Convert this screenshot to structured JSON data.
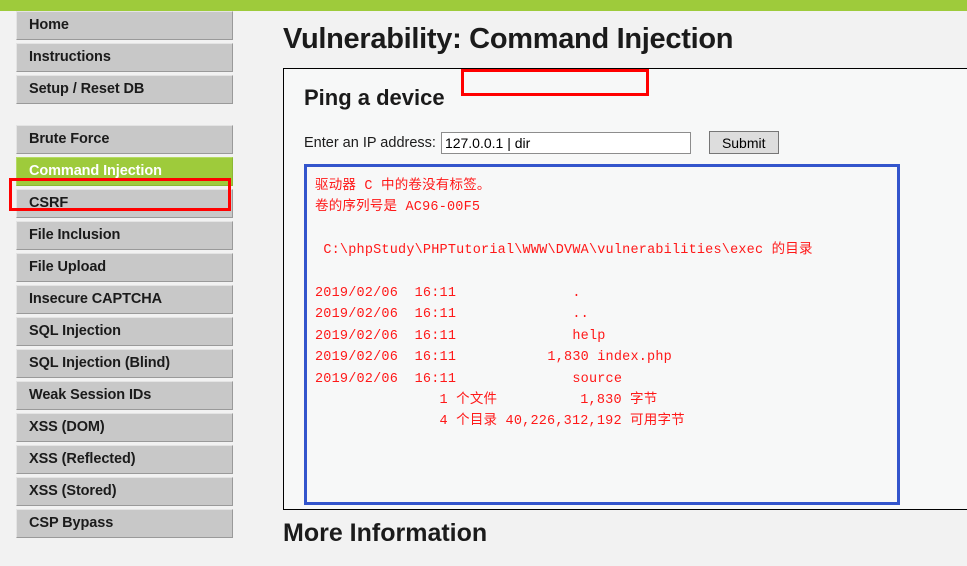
{
  "theme": {
    "accent_green": "#9ECB3B",
    "annotation_red": "#FF0000",
    "output_border_blue": "#3355CC",
    "output_text_red": "#FF1818",
    "nav_background": "#c8c8c8"
  },
  "sidebar": {
    "primary_items": [
      {
        "label": "Home",
        "active": false
      },
      {
        "label": "Instructions",
        "active": false
      },
      {
        "label": "Setup / Reset DB",
        "active": false
      }
    ],
    "vulnerability_items": [
      {
        "label": "Brute Force",
        "active": false
      },
      {
        "label": "Command Injection",
        "active": true
      },
      {
        "label": "CSRF",
        "active": false
      },
      {
        "label": "File Inclusion",
        "active": false
      },
      {
        "label": "File Upload",
        "active": false
      },
      {
        "label": "Insecure CAPTCHA",
        "active": false
      },
      {
        "label": "SQL Injection",
        "active": false
      },
      {
        "label": "SQL Injection (Blind)",
        "active": false
      },
      {
        "label": "Weak Session IDs",
        "active": false
      },
      {
        "label": "XSS (DOM)",
        "active": false
      },
      {
        "label": "XSS (Reflected)",
        "active": false
      },
      {
        "label": "XSS (Stored)",
        "active": false
      },
      {
        "label": "CSP Bypass",
        "active": false
      }
    ]
  },
  "main": {
    "page_title": "Vulnerability: Command Injection",
    "vuln_heading": "Ping a device",
    "form": {
      "ip_label": "Enter an IP address:",
      "ip_value": "127.0.0.1 | dir",
      "ip_placeholder": "",
      "submit_label": "Submit"
    },
    "command_output": "驱动器 C 中的卷没有标签。\n卷的序列号是 AC96-00F5\n\n C:\\phpStudy\\PHPTutorial\\WWW\\DVWA\\vulnerabilities\\exec 的目录\n\n2019/02/06  16:11              .\n2019/02/06  16:11              ..\n2019/02/06  16:11              help\n2019/02/06  16:11           1,830 index.php\n2019/02/06  16:11              source\n               1 个文件          1,830 字节\n               4 个目录 40,226,312,192 可用字节",
    "more_information_title": "More Information"
  }
}
